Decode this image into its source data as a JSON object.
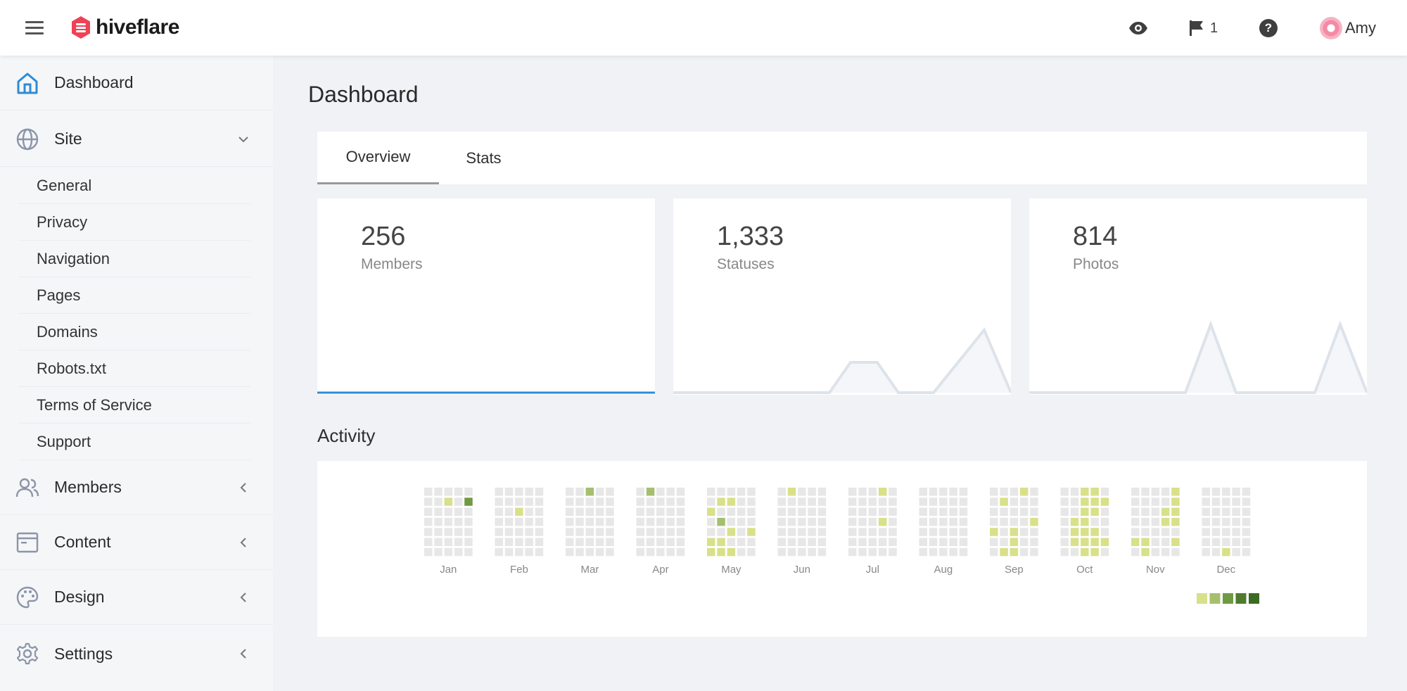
{
  "header": {
    "brand": "hiveflare",
    "notifications_count": "1",
    "user_name": "Amy",
    "brand_color": "#ef4257"
  },
  "sidebar": {
    "dashboard": "Dashboard",
    "site": "Site",
    "site_items": [
      "General",
      "Privacy",
      "Navigation",
      "Pages",
      "Domains",
      "Robots.txt",
      "Terms of Service",
      "Support"
    ],
    "members": "Members",
    "content": "Content",
    "design": "Design",
    "settings": "Settings"
  },
  "main": {
    "title": "Dashboard",
    "tabs": [
      "Overview",
      "Stats"
    ],
    "stats": [
      {
        "value": "256",
        "label": "Members"
      },
      {
        "value": "1,333",
        "label": "Statuses"
      },
      {
        "value": "814",
        "label": "Photos"
      }
    ],
    "activity_title": "Activity",
    "months": [
      "Jan",
      "Feb",
      "Mar",
      "Apr",
      "May",
      "Jun",
      "Jul",
      "Aug",
      "Sep",
      "Oct",
      "Nov",
      "Dec"
    ],
    "activity_levels": [
      [
        0,
        0,
        0,
        0,
        0,
        0,
        0,
        0,
        0,
        0,
        0,
        0,
        0,
        0,
        0,
        1,
        0,
        0,
        0,
        0,
        0,
        0,
        0,
        0,
        0,
        0,
        0,
        0,
        0,
        3,
        0,
        0,
        0,
        0,
        0
      ],
      [
        0,
        0,
        0,
        0,
        0,
        0,
        0,
        0,
        0,
        0,
        0,
        0,
        0,
        0,
        0,
        0,
        1,
        0,
        0,
        0,
        0,
        0,
        0,
        0,
        0,
        0,
        0,
        0,
        0,
        0,
        0,
        0,
        0,
        0,
        0
      ],
      [
        0,
        0,
        0,
        0,
        0,
        0,
        0,
        0,
        0,
        0,
        0,
        0,
        0,
        0,
        2,
        0,
        0,
        0,
        0,
        0,
        0,
        0,
        0,
        0,
        0,
        0,
        0,
        0,
        0,
        0,
        0,
        0,
        0,
        0,
        0
      ],
      [
        0,
        0,
        0,
        0,
        0,
        0,
        0,
        2,
        0,
        0,
        0,
        0,
        0,
        0,
        0,
        0,
        0,
        0,
        0,
        0,
        0,
        0,
        0,
        0,
        0,
        0,
        0,
        0,
        0,
        0,
        0,
        0,
        0,
        0,
        0
      ],
      [
        0,
        0,
        1,
        0,
        0,
        1,
        1,
        0,
        1,
        0,
        2,
        0,
        1,
        1,
        0,
        1,
        0,
        0,
        1,
        0,
        1,
        0,
        0,
        0,
        0,
        0,
        0,
        0,
        0,
        0,
        0,
        0,
        1,
        0,
        0
      ],
      [
        0,
        0,
        0,
        0,
        0,
        0,
        0,
        1,
        0,
        0,
        0,
        0,
        0,
        0,
        0,
        0,
        0,
        0,
        0,
        0,
        0,
        0,
        0,
        0,
        0,
        0,
        0,
        0,
        0,
        0,
        0,
        0,
        0,
        0,
        0
      ],
      [
        0,
        0,
        0,
        0,
        0,
        0,
        0,
        0,
        0,
        0,
        0,
        0,
        0,
        0,
        0,
        0,
        0,
        0,
        0,
        0,
        0,
        1,
        0,
        0,
        1,
        0,
        0,
        0,
        0,
        0,
        0,
        0,
        0,
        0,
        0
      ],
      [
        0,
        0,
        0,
        0,
        0,
        0,
        0,
        0,
        0,
        0,
        0,
        0,
        0,
        0,
        0,
        0,
        0,
        0,
        0,
        0,
        0,
        0,
        0,
        0,
        0,
        0,
        0,
        0,
        0,
        0,
        0,
        0,
        0,
        0,
        0
      ],
      [
        0,
        0,
        0,
        0,
        1,
        0,
        0,
        0,
        1,
        0,
        0,
        0,
        0,
        1,
        0,
        0,
        0,
        0,
        1,
        1,
        1,
        1,
        0,
        0,
        0,
        0,
        0,
        0,
        0,
        0,
        0,
        1,
        0,
        0,
        0
      ],
      [
        0,
        0,
        0,
        0,
        0,
        0,
        0,
        0,
        0,
        0,
        1,
        1,
        1,
        0,
        1,
        1,
        1,
        1,
        1,
        1,
        1,
        1,
        1,
        1,
        0,
        1,
        1,
        1,
        0,
        1,
        0,
        0,
        0,
        1,
        0
      ],
      [
        0,
        0,
        0,
        0,
        0,
        1,
        0,
        0,
        0,
        0,
        0,
        0,
        1,
        1,
        0,
        0,
        0,
        0,
        0,
        0,
        0,
        0,
        0,
        1,
        1,
        0,
        0,
        0,
        1,
        1,
        1,
        1,
        0,
        1,
        0
      ],
      [
        0,
        0,
        0,
        0,
        0,
        0,
        0,
        0,
        0,
        0,
        0,
        0,
        0,
        0,
        0,
        0,
        0,
        0,
        0,
        0,
        1,
        0,
        0,
        0,
        0,
        0,
        0,
        0,
        0,
        0,
        0,
        0,
        0,
        0,
        0
      ]
    ],
    "activity_colors": [
      "#e7e7e7",
      "#d8e08a",
      "#a6bf6e",
      "#6f9a43",
      "#3c6a22",
      "#3c6a22"
    ],
    "legend_colors": [
      "#d8e08a",
      "#a6bf6e",
      "#6f9a43",
      "#4f7a30",
      "#3c6a22"
    ],
    "accent": "#2e8bd6"
  }
}
